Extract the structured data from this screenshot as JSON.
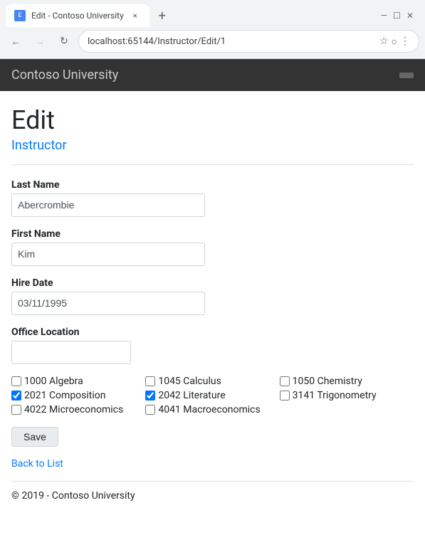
{
  "browser": {
    "tab_title": "Edit - Contoso University",
    "tab_close": "×",
    "new_tab": "+",
    "window_controls": {
      "minimize": "—",
      "maximize": "☐",
      "close": "✕"
    },
    "nav": {
      "back": "←",
      "forward": "→",
      "refresh": "↻",
      "url": "localhost:65144/Instructor/Edit/1",
      "bookmark": "☆",
      "account": "○",
      "menu": "⋮"
    }
  },
  "header": {
    "title": "Contoso University",
    "button_label": ""
  },
  "page": {
    "heading": "Edit",
    "subheading": "Instructor"
  },
  "form": {
    "last_name_label": "Last Name",
    "last_name_value": "Abercrombie",
    "last_name_placeholder": "",
    "first_name_label": "First Name",
    "first_name_value": "Kim",
    "first_name_placeholder": "",
    "hire_date_label": "Hire Date",
    "hire_date_value": "03/11/1995",
    "hire_date_placeholder": "",
    "office_location_label": "Office Location",
    "office_location_value": "",
    "office_location_placeholder": ""
  },
  "courses": [
    {
      "id": "1000",
      "name": "Algebra",
      "checked": false
    },
    {
      "id": "1045",
      "name": "Calculus",
      "checked": false
    },
    {
      "id": "1050",
      "name": "Chemistry",
      "checked": false
    },
    {
      "id": "2021",
      "name": "Composition",
      "checked": true
    },
    {
      "id": "2042",
      "name": "Literature",
      "checked": true
    },
    {
      "id": "3141",
      "name": "Trigonometry",
      "checked": false
    },
    {
      "id": "4022",
      "name": "Microeconomics",
      "checked": false
    },
    {
      "id": "4041",
      "name": "Macroeconomics",
      "checked": false
    }
  ],
  "buttons": {
    "save_label": "Save"
  },
  "links": {
    "back_to_list": "Back to List"
  },
  "footer": {
    "copyright": "© 2019 - Contoso University"
  }
}
